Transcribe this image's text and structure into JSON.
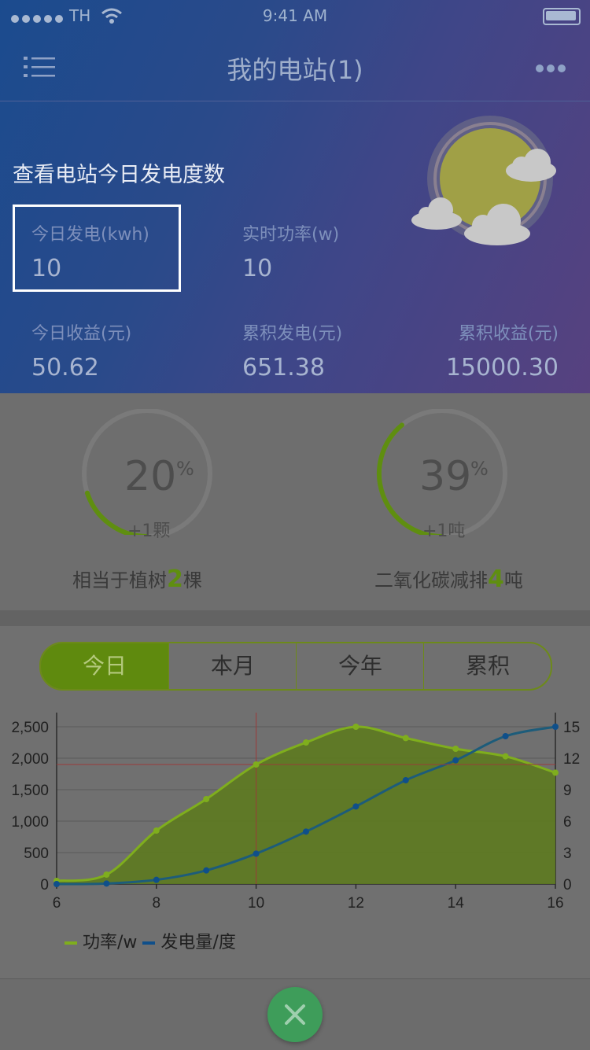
{
  "status": {
    "carrier": "TH",
    "time": "9:41 AM"
  },
  "nav": {
    "title": "我的电站(1)"
  },
  "hero": {
    "heading": "查看电站今日发电度数",
    "today_power_label": "今日发电(kwh)",
    "today_power_value": "10",
    "realtime_label": "实时功率(w)",
    "realtime_value": "10",
    "today_income_label": "今日收益(元)",
    "today_income_value": "50.62",
    "total_power_label": "累积发电(元)",
    "total_power_value": "651.38",
    "total_income_label": "累积收益(元)",
    "total_income_value": "15000.30"
  },
  "stats": {
    "tree": {
      "percent": "20",
      "pct_sign": "%",
      "delta": "+1颗",
      "pre": "相当于植树",
      "num": "2",
      "post": "棵",
      "progress": 0.2
    },
    "co2": {
      "percent": "39",
      "pct_sign": "%",
      "delta": "+1吨",
      "pre": "二氧化碳减排",
      "num": "4",
      "post": "吨",
      "progress": 0.39
    }
  },
  "tabs": [
    "今日",
    "本月",
    "今年",
    "累积"
  ],
  "colors": {
    "accent": "#6b9a12",
    "power": "#7fae1d",
    "energy": "#0f4f8a"
  },
  "chart_data": {
    "type": "line",
    "x": [
      6,
      7,
      8,
      9,
      10,
      11,
      12,
      13,
      14,
      15,
      16
    ],
    "xticks": [
      "6",
      "8",
      "10",
      "12",
      "14",
      "16"
    ],
    "y_left_ticks": [
      "0",
      "500",
      "1,000",
      "1,500",
      "2,000",
      "2,500"
    ],
    "y_right_ticks": [
      "0",
      "3",
      "6",
      "9",
      "12",
      "15"
    ],
    "ylim_left": [
      0,
      2500
    ],
    "ylim_right": [
      0,
      15
    ],
    "series": [
      {
        "name": "功率/w",
        "axis": "left",
        "style": "area",
        "values": [
          50,
          150,
          850,
          1350,
          1900,
          2250,
          2500,
          2320,
          2150,
          2030,
          1770
        ]
      },
      {
        "name": "发电量/度",
        "axis": "right",
        "style": "line",
        "values": [
          0,
          0.05,
          0.4,
          1.3,
          2.9,
          5.0,
          7.4,
          9.9,
          11.8,
          14.1,
          15.0
        ]
      }
    ],
    "crosshair": {
      "x": 10,
      "y": 1900
    },
    "legend": "bottom-left"
  }
}
